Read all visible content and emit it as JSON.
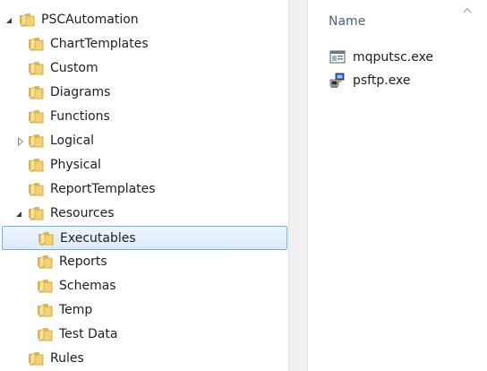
{
  "nav": {
    "items": [
      {
        "label": "PSCAutomation",
        "expander": "expanded"
      },
      {
        "label": "ChartTemplates",
        "expander": "none"
      },
      {
        "label": "Custom",
        "expander": "none"
      },
      {
        "label": "Diagrams",
        "expander": "none"
      },
      {
        "label": "Functions",
        "expander": "none"
      },
      {
        "label": "Logical",
        "expander": "collapsed"
      },
      {
        "label": "Physical",
        "expander": "none"
      },
      {
        "label": "ReportTemplates",
        "expander": "none"
      },
      {
        "label": "Resources",
        "expander": "expanded"
      },
      {
        "label": "Executables",
        "expander": "none",
        "selected": true
      },
      {
        "label": "Reports",
        "expander": "none"
      },
      {
        "label": "Schemas",
        "expander": "none"
      },
      {
        "label": "Temp",
        "expander": "none"
      },
      {
        "label": "Test Data",
        "expander": "none"
      },
      {
        "label": "Rules",
        "expander": "none"
      }
    ]
  },
  "content": {
    "column_header": "Name",
    "sort_indicator": "sort-ascending-arrow",
    "files": [
      {
        "name": "mqputsc.exe",
        "icon": "console-app-icon"
      },
      {
        "name": "psftp.exe",
        "icon": "putty-terminal-icon"
      }
    ]
  },
  "colors": {
    "selection_fill": "#dbeaf9",
    "selection_border": "#84acdd",
    "folder_yellow": "#f3d277",
    "header_text": "#4c607a"
  }
}
